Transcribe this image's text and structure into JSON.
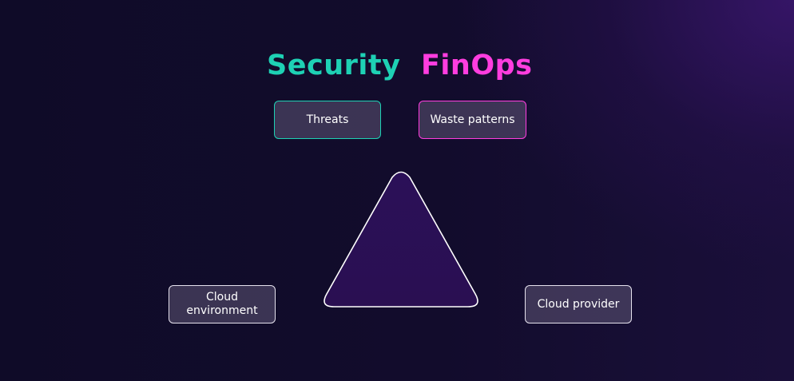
{
  "headings": {
    "security": "Security",
    "finops": "FinOps"
  },
  "boxes": {
    "threats": "Threats",
    "waste_patterns": "Waste patterns",
    "cloud_environment_line1": "Cloud",
    "cloud_environment_line2": "environment",
    "cloud_provider": "Cloud provider"
  },
  "colors": {
    "security": "#1ed1b4",
    "finops": "#ff3ddf",
    "triangle_fill": "#2a0f55",
    "triangle_stroke": "#ffffff",
    "box_text": "#ffffff"
  }
}
